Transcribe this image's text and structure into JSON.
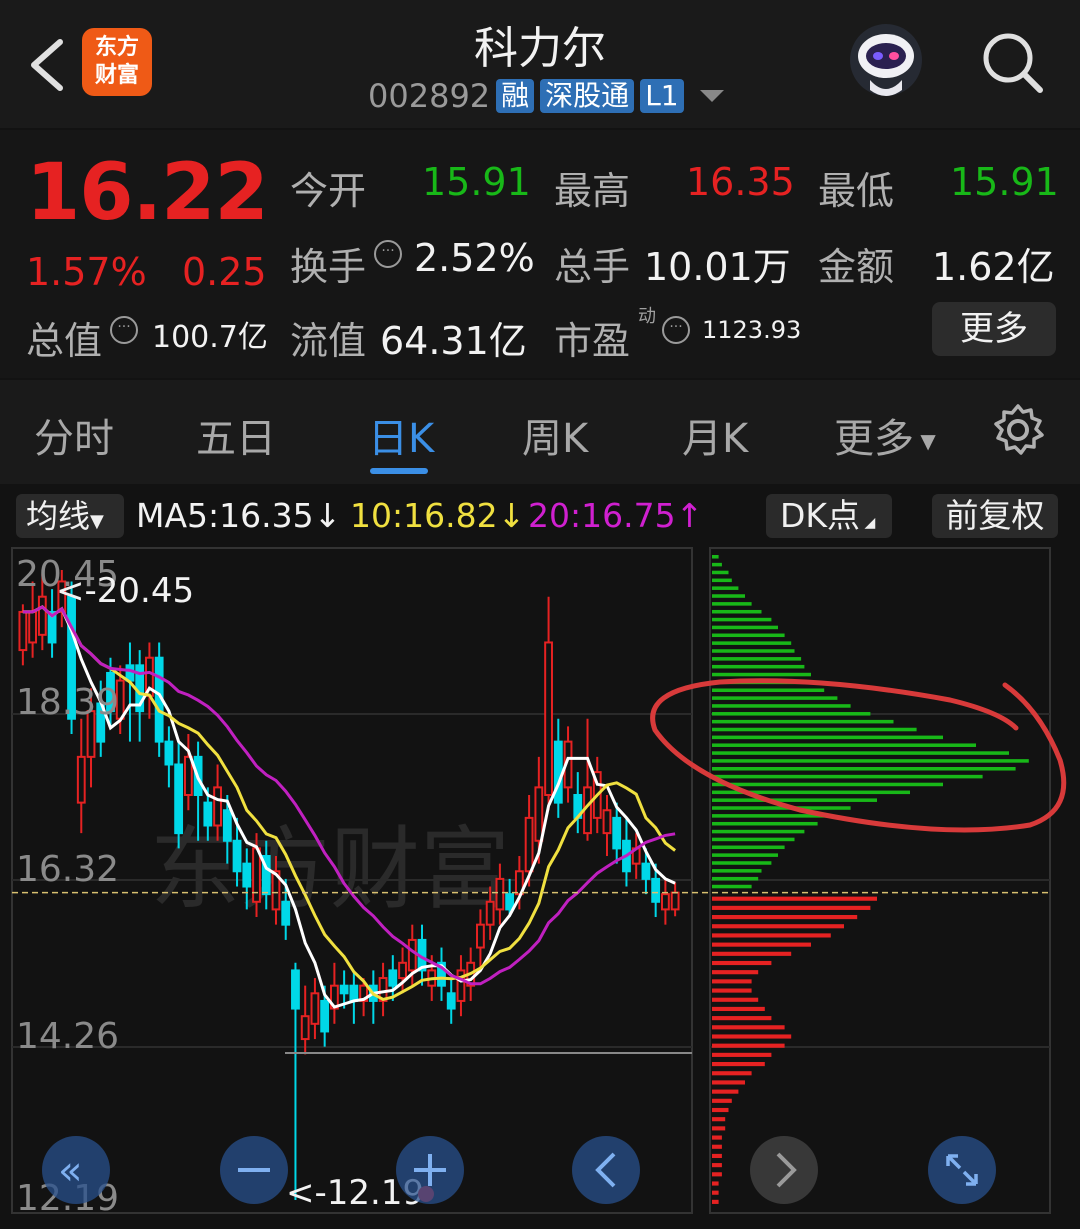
{
  "header": {
    "title": "科力尔",
    "logo_line1": "东方",
    "logo_line2": "财富",
    "code": "002892",
    "tags": [
      "融",
      "深股通",
      "L1"
    ]
  },
  "quote": {
    "price": "16.22",
    "pct": "1.57%",
    "change": "0.25",
    "open_label": "今开",
    "open_value": "15.91",
    "high_label": "最高",
    "high_value": "16.35",
    "low_label": "最低",
    "low_value": "15.91",
    "turnover_label": "换手",
    "turnover_value": "2.52%",
    "volume_label": "总手",
    "volume_value": "10.01万",
    "amount_label": "金额",
    "amount_value": "1.62亿",
    "mktcap_label": "总值",
    "mktcap_value": "100.7亿",
    "float_label": "流值",
    "float_value": "64.31亿",
    "pe_label": "市盈",
    "pe_sup": "动",
    "pe_value": "1123.93",
    "more_label": "更多"
  },
  "tabs": [
    "分时",
    "五日",
    "日K",
    "周K",
    "月K",
    "更多"
  ],
  "ma_row": {
    "junxian": "均线",
    "ma5": "MA5:16.35↓",
    "ma10": "10:16.82↓",
    "ma20": "20:16.75↑",
    "dk": "DK点",
    "fq": "前复权"
  },
  "colors": {
    "up": "#e62222",
    "down": "#18b818",
    "candle_down": "#00d8e8",
    "ma5": "#ffffff",
    "ma10": "#f0e040",
    "ma20": "#c020c0",
    "accent": "#3b8fe6"
  },
  "chart_data": {
    "type": "candlestick",
    "y_ticks": [
      "20.45",
      "18.39",
      "16.32",
      "14.26",
      "12.19"
    ],
    "ylim": [
      12.19,
      20.45
    ],
    "last_price_line": 16.22,
    "max_label": "<-20.45",
    "min_label": "<-12.19",
    "candles": [
      {
        "o": 19.4,
        "c": 19.9,
        "h": 20.0,
        "l": 19.2
      },
      {
        "o": 19.5,
        "c": 19.9,
        "h": 20.3,
        "l": 19.3
      },
      {
        "o": 19.6,
        "c": 20.1,
        "h": 20.4,
        "l": 19.4
      },
      {
        "o": 19.9,
        "c": 19.5,
        "h": 20.2,
        "l": 19.3
      },
      {
        "o": 19.9,
        "c": 20.3,
        "h": 20.45,
        "l": 19.7
      },
      {
        "o": 20.1,
        "c": 18.5,
        "h": 20.3,
        "l": 18.3
      },
      {
        "o": 17.4,
        "c": 18.0,
        "h": 18.5,
        "l": 17.0
      },
      {
        "o": 18.0,
        "c": 18.6,
        "h": 18.9,
        "l": 17.6
      },
      {
        "o": 18.7,
        "c": 18.2,
        "h": 19.0,
        "l": 18.0
      },
      {
        "o": 19.1,
        "c": 18.6,
        "h": 19.3,
        "l": 18.4
      },
      {
        "o": 18.5,
        "c": 19.0,
        "h": 19.2,
        "l": 18.3
      },
      {
        "o": 19.2,
        "c": 19.0,
        "h": 19.5,
        "l": 18.2
      },
      {
        "o": 19.2,
        "c": 18.6,
        "h": 19.4,
        "l": 18.2
      },
      {
        "o": 18.8,
        "c": 19.3,
        "h": 19.5,
        "l": 18.5
      },
      {
        "o": 19.3,
        "c": 18.2,
        "h": 19.5,
        "l": 18.0
      },
      {
        "o": 18.2,
        "c": 17.9,
        "h": 18.4,
        "l": 17.6
      },
      {
        "o": 17.9,
        "c": 17.0,
        "h": 18.2,
        "l": 16.8
      },
      {
        "o": 17.5,
        "c": 18.0,
        "h": 18.3,
        "l": 17.3
      },
      {
        "o": 18.0,
        "c": 17.5,
        "h": 18.2,
        "l": 16.9
      },
      {
        "o": 17.4,
        "c": 17.1,
        "h": 17.6,
        "l": 16.9
      },
      {
        "o": 17.1,
        "c": 17.6,
        "h": 17.9,
        "l": 16.9
      },
      {
        "o": 17.3,
        "c": 16.9,
        "h": 17.5,
        "l": 16.6
      },
      {
        "o": 16.9,
        "c": 16.5,
        "h": 17.2,
        "l": 16.3
      },
      {
        "o": 16.6,
        "c": 16.3,
        "h": 16.8,
        "l": 16.0
      },
      {
        "o": 16.1,
        "c": 16.8,
        "h": 17.0,
        "l": 15.9
      },
      {
        "o": 16.7,
        "c": 16.2,
        "h": 16.9,
        "l": 16.0
      },
      {
        "o": 16.0,
        "c": 16.5,
        "h": 16.7,
        "l": 15.8
      },
      {
        "o": 16.1,
        "c": 15.8,
        "h": 16.4,
        "l": 15.6
      },
      {
        "o": 15.2,
        "c": 14.7,
        "h": 15.3,
        "l": 12.19
      },
      {
        "o": 14.3,
        "c": 14.6,
        "h": 15.0,
        "l": 14.1
      },
      {
        "o": 14.5,
        "c": 14.9,
        "h": 15.1,
        "l": 14.3
      },
      {
        "o": 14.8,
        "c": 14.4,
        "h": 15.0,
        "l": 14.2
      },
      {
        "o": 14.7,
        "c": 15.0,
        "h": 15.3,
        "l": 14.5
      },
      {
        "o": 15.0,
        "c": 14.9,
        "h": 15.2,
        "l": 14.7
      },
      {
        "o": 15.0,
        "c": 14.8,
        "h": 15.2,
        "l": 14.5
      },
      {
        "o": 14.8,
        "c": 15.0,
        "h": 15.1,
        "l": 14.6
      },
      {
        "o": 15.0,
        "c": 14.8,
        "h": 15.2,
        "l": 14.5
      },
      {
        "o": 14.8,
        "c": 15.1,
        "h": 15.3,
        "l": 14.6
      },
      {
        "o": 15.2,
        "c": 15.0,
        "h": 15.4,
        "l": 14.8
      },
      {
        "o": 15.1,
        "c": 15.3,
        "h": 15.5,
        "l": 14.9
      },
      {
        "o": 15.2,
        "c": 15.6,
        "h": 15.8,
        "l": 15.0
      },
      {
        "o": 15.6,
        "c": 15.2,
        "h": 15.8,
        "l": 15.0
      },
      {
        "o": 15.0,
        "c": 15.2,
        "h": 15.4,
        "l": 14.8
      },
      {
        "o": 15.3,
        "c": 15.0,
        "h": 15.5,
        "l": 14.8
      },
      {
        "o": 14.9,
        "c": 14.7,
        "h": 15.1,
        "l": 14.5
      },
      {
        "o": 14.8,
        "c": 15.2,
        "h": 15.4,
        "l": 14.6
      },
      {
        "o": 15.0,
        "c": 15.3,
        "h": 15.5,
        "l": 14.8
      },
      {
        "o": 15.5,
        "c": 15.8,
        "h": 16.0,
        "l": 15.2
      },
      {
        "o": 15.8,
        "c": 16.1,
        "h": 16.3,
        "l": 15.6
      },
      {
        "o": 16.0,
        "c": 16.4,
        "h": 16.6,
        "l": 15.8
      },
      {
        "o": 16.2,
        "c": 16.0,
        "h": 16.4,
        "l": 15.9
      },
      {
        "o": 16.2,
        "c": 16.5,
        "h": 16.7,
        "l": 16.0
      },
      {
        "o": 16.5,
        "c": 17.2,
        "h": 17.5,
        "l": 16.3
      },
      {
        "o": 16.9,
        "c": 17.6,
        "h": 18.0,
        "l": 16.6
      },
      {
        "o": 17.5,
        "c": 19.5,
        "h": 20.1,
        "l": 17.3
      },
      {
        "o": 18.2,
        "c": 17.4,
        "h": 18.5,
        "l": 17.2
      },
      {
        "o": 17.6,
        "c": 18.2,
        "h": 18.4,
        "l": 17.4
      },
      {
        "o": 17.5,
        "c": 17.2,
        "h": 17.8,
        "l": 17.0
      },
      {
        "o": 17.0,
        "c": 17.6,
        "h": 18.5,
        "l": 16.9
      },
      {
        "o": 17.2,
        "c": 17.8,
        "h": 18.0,
        "l": 17.0
      },
      {
        "o": 17.0,
        "c": 17.3,
        "h": 17.5,
        "l": 16.7
      },
      {
        "o": 17.2,
        "c": 16.8,
        "h": 17.4,
        "l": 16.6
      },
      {
        "o": 16.9,
        "c": 16.5,
        "h": 17.2,
        "l": 16.3
      },
      {
        "o": 16.6,
        "c": 16.8,
        "h": 17.0,
        "l": 16.4
      },
      {
        "o": 16.6,
        "c": 16.4,
        "h": 16.8,
        "l": 16.2
      },
      {
        "o": 16.4,
        "c": 16.1,
        "h": 16.6,
        "l": 15.9
      },
      {
        "o": 16.0,
        "c": 16.2,
        "h": 16.4,
        "l": 15.8
      },
      {
        "o": 16.0,
        "c": 16.22,
        "h": 16.35,
        "l": 15.91
      }
    ]
  },
  "profile": {
    "levels_green": [
      0.02,
      0.03,
      0.05,
      0.06,
      0.08,
      0.1,
      0.12,
      0.15,
      0.18,
      0.2,
      0.22,
      0.24,
      0.25,
      0.27,
      0.28,
      0.3,
      0.32,
      0.34,
      0.38,
      0.42,
      0.48,
      0.55,
      0.62,
      0.7,
      0.8,
      0.9,
      0.96,
      0.92,
      0.82,
      0.7,
      0.6,
      0.5,
      0.42,
      0.36,
      0.32,
      0.28,
      0.25,
      0.22,
      0.2,
      0.18,
      0.15,
      0.14,
      0.12
    ],
    "levels_red": [
      0.5,
      0.48,
      0.44,
      0.4,
      0.36,
      0.3,
      0.24,
      0.18,
      0.14,
      0.12,
      0.12,
      0.14,
      0.16,
      0.18,
      0.22,
      0.24,
      0.22,
      0.18,
      0.16,
      0.12,
      0.1,
      0.08,
      0.06,
      0.05,
      0.04,
      0.04,
      0.03,
      0.03,
      0.03,
      0.03,
      0.03,
      0.02,
      0.02,
      0.02
    ]
  }
}
